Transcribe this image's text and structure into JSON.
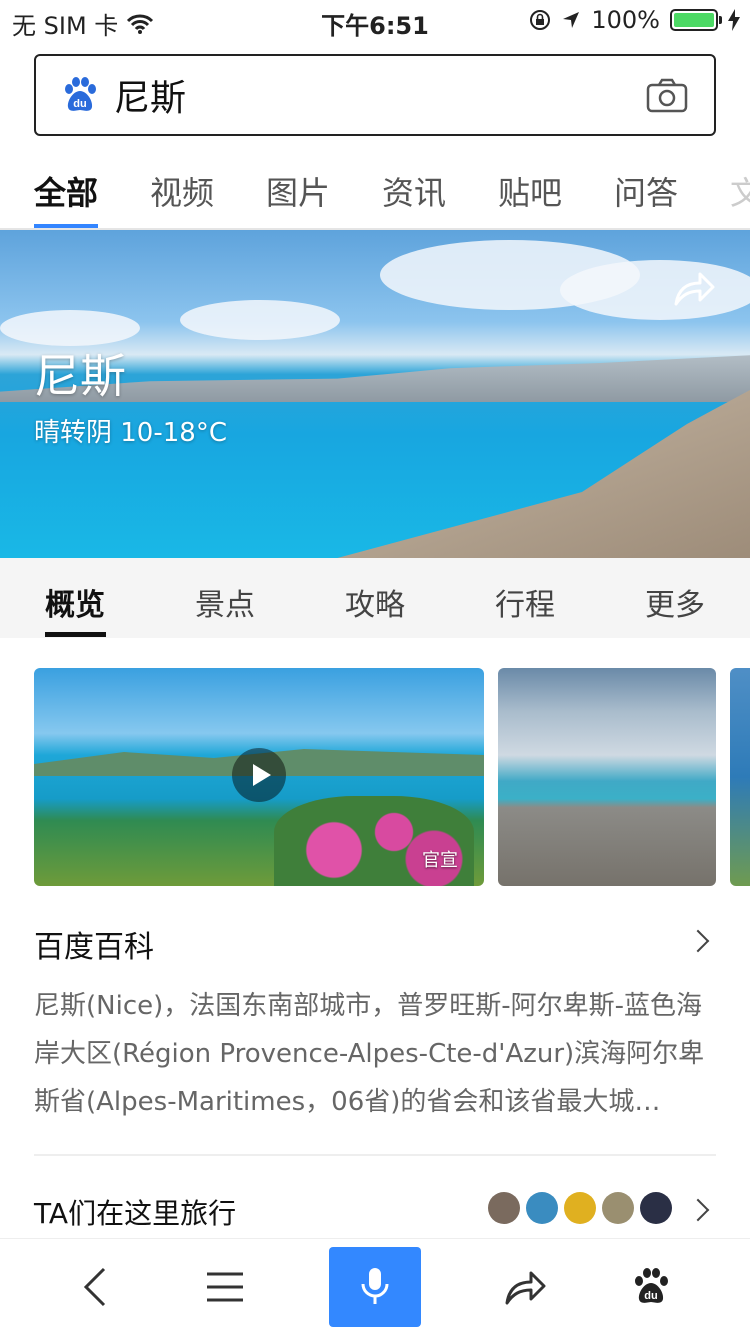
{
  "status_bar": {
    "carrier": "无 SIM 卡",
    "time": "下午6:51",
    "battery_percent": "100%",
    "battery_level": 1.0,
    "battery_color": "#4cd964"
  },
  "search": {
    "query": "尼斯",
    "logo_icon": "baidu-paw-icon",
    "camera_icon": "camera-icon"
  },
  "category_tabs": [
    {
      "label": "全部",
      "active": true
    },
    {
      "label": "视频",
      "active": false
    },
    {
      "label": "图片",
      "active": false
    },
    {
      "label": "资讯",
      "active": false
    },
    {
      "label": "贴吧",
      "active": false
    },
    {
      "label": "问答",
      "active": false
    },
    {
      "label": "文",
      "active": false
    }
  ],
  "hero": {
    "title": "尼斯",
    "weather": "晴转阴 10-18°C",
    "share_icon": "share-icon"
  },
  "sub_tabs": [
    {
      "label": "概览",
      "active": true
    },
    {
      "label": "景点",
      "active": false
    },
    {
      "label": "攻略",
      "active": false
    },
    {
      "label": "行程",
      "active": false
    },
    {
      "label": "更多",
      "active": false
    }
  ],
  "media": {
    "video_badge": "官宣"
  },
  "baike": {
    "title": "百度百科",
    "text": "尼斯(Nice)，法国东南部城市，普罗旺斯-阿尔卑斯-蓝色海岸大区(Région Provence-Alpes-Cte-d'Azur)滨海阿尔卑斯省(Alpes-Maritimes，06省)的省会和该省最大城…"
  },
  "travel": {
    "title": "TA们在这里旅行",
    "avatar_colors": [
      "#7a6a5e",
      "#3a8cc0",
      "#e0b020",
      "#9a8f70",
      "#2a2f45"
    ]
  },
  "bottom_bar": {
    "items": [
      "back-icon",
      "menu-icon",
      "mic-icon",
      "share-icon",
      "baidu-paw-icon"
    ],
    "accent": "#3388ff"
  },
  "colors": {
    "tab_underline": "#3385ff"
  }
}
